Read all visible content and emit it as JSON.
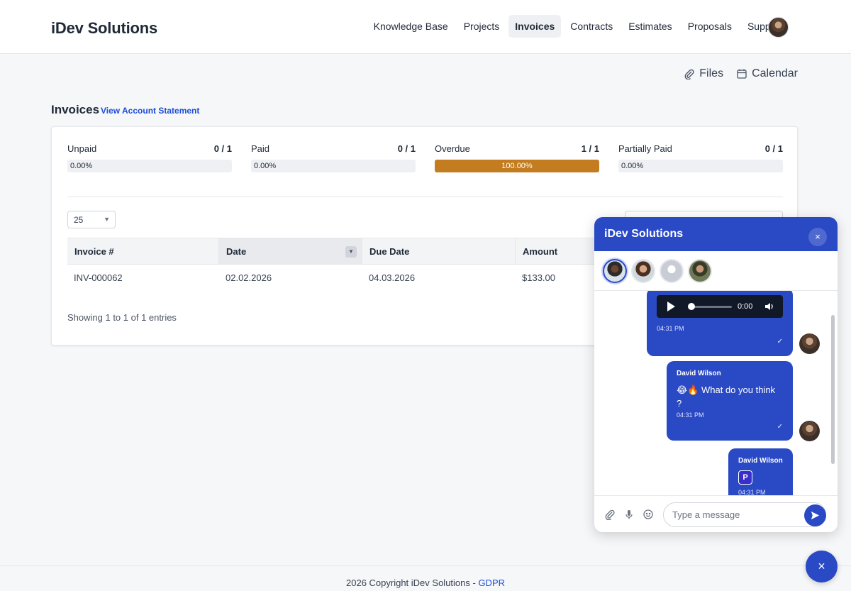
{
  "header": {
    "brand": "iDev Solutions",
    "nav": [
      {
        "label": "Knowledge Base",
        "active": false
      },
      {
        "label": "Projects",
        "active": false
      },
      {
        "label": "Invoices",
        "active": true
      },
      {
        "label": "Contracts",
        "active": false
      },
      {
        "label": "Estimates",
        "active": false
      },
      {
        "label": "Proposals",
        "active": false
      },
      {
        "label": "Support",
        "active": false
      }
    ]
  },
  "toplinks": {
    "files": "Files",
    "calendar": "Calendar"
  },
  "page": {
    "title": "Invoices",
    "statement_link": "View Account Statement"
  },
  "stats": [
    {
      "label": "Unpaid",
      "count": "0 / 1",
      "percent_text": "0.00%",
      "percent": 0
    },
    {
      "label": "Paid",
      "count": "0 / 1",
      "percent_text": "0.00%",
      "percent": 0
    },
    {
      "label": "Overdue",
      "count": "1 / 1",
      "percent_text": "100.00%",
      "percent": 100
    },
    {
      "label": "Partially Paid",
      "count": "0 / 1",
      "percent_text": "0.00%",
      "percent": 0
    }
  ],
  "table": {
    "per_page": "25",
    "columns": [
      "Invoice #",
      "Date",
      "Due Date",
      "Amount"
    ],
    "rows": [
      {
        "invoice": "INV-000062",
        "date": "02.02.2026",
        "due": "04.03.2026",
        "amount": "$133.00"
      }
    ],
    "showing": "Showing 1 to 1 of 1 entries"
  },
  "footer": {
    "text": "2026 Copyright iDev Solutions - ",
    "link": "GDPR"
  },
  "chat": {
    "title": "iDev Solutions",
    "close": "×",
    "messages": [
      {
        "type": "audio",
        "time_display": "0:00",
        "timestamp": "04:31 PM"
      },
      {
        "type": "text",
        "sender": "David Wilson",
        "line1": "😂🔥 What do you think",
        "line2": "?",
        "timestamp": "04:31 PM"
      },
      {
        "type": "file",
        "sender": "David Wilson",
        "timestamp": "04:31 PM"
      }
    ],
    "input_placeholder": "Type a message",
    "fab": "×"
  },
  "colors": {
    "brand": "#2a49c5",
    "overdue": "#c37d20",
    "link": "#1d4ed8"
  }
}
